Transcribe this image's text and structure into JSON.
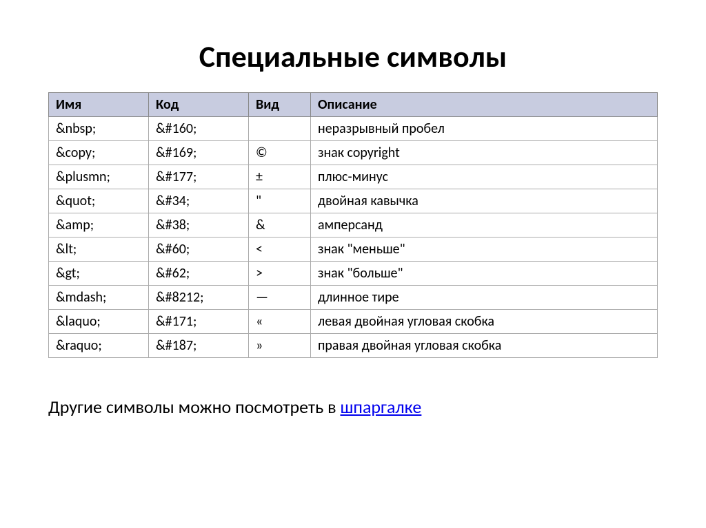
{
  "title": "Специальные символы",
  "headers": {
    "name": "Имя",
    "code": "Код",
    "view": "Вид",
    "desc": "Описание"
  },
  "rows": [
    {
      "name": "&nbsp;",
      "code": "&#160;",
      "view": " ",
      "desc": "неразрывный пробел"
    },
    {
      "name": "&copy;",
      "code": "&#169;",
      "view": "©",
      "desc": "знак copyright"
    },
    {
      "name": "&plusmn;",
      "code": "&#177;",
      "view": "±",
      "desc": "плюс-минус"
    },
    {
      "name": "&quot;",
      "code": "&#34;",
      "view": "\"",
      "desc": "двойная кавычка"
    },
    {
      "name": "&amp;",
      "code": "&#38;",
      "view": "&",
      "desc": "амперсанд"
    },
    {
      "name": "&lt;",
      "code": "&#60;",
      "view": "<",
      "desc": "знак \"меньше\""
    },
    {
      "name": "&gt;",
      "code": "&#62;",
      "view": ">",
      "desc": "знак \"больше\""
    },
    {
      "name": "&mdash;",
      "code": "&#8212;",
      "view": "—",
      "desc": "длинное тире"
    },
    {
      "name": "&laquo;",
      "code": "&#171;",
      "view": "«",
      "desc": "левая двойная угловая скобка"
    },
    {
      "name": "&raquo;",
      "code": "&#187;",
      "view": "»",
      "desc": "правая двойная угловая скобка"
    }
  ],
  "footer": {
    "prefix": "Другие символы можно посмотреть в ",
    "link": "шпаргалке"
  }
}
